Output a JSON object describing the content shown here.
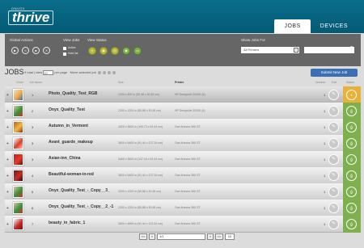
{
  "brand": {
    "subtitle": "ONVOX",
    "name": "thrive"
  },
  "tabs": [
    {
      "label": "JOBS",
      "active": true
    },
    {
      "label": "DEVICES",
      "active": false
    }
  ],
  "toolbar": {
    "global_actions_label": "Global Actions",
    "global_icons": [
      "play-icon",
      "pause-icon",
      "stop-icon",
      "cancel-icon"
    ],
    "view_jobs_label": "View Jobs",
    "view_jobs_options": [
      {
        "label": "Active",
        "checked": true
      },
      {
        "label": "Hold list",
        "checked": false
      }
    ],
    "view_status_label": "View Status",
    "status_icons": [
      "hold-status-icon",
      "rip-status-icon",
      "print-status-icon",
      "done-status-icon",
      "archive-status-icon"
    ],
    "show_jobs_for_label": "Show Jobs For",
    "printer_filter": "All Printers",
    "search_placeholder": ""
  },
  "jobs_bar": {
    "title": "JOBS",
    "count_text": "9 total | view",
    "per_page": "10",
    "per_page_label": "per page",
    "move_selected": "Move selected job",
    "submit_label": "Submit New Job"
  },
  "columns": {
    "order": "Order",
    "job_name": "Job Name",
    "size": "Size",
    "printer": "Printer",
    "copies": "Number",
    "edit": "Edit",
    "status": "Status"
  },
  "jobs": [
    {
      "order": "1",
      "name": "Photo_Quality_Test_RGB",
      "size": "1200 x 820 in (30.48 x 20.83 cm)",
      "printer": "HP DesignJet Z6100 (6)",
      "copies": "1",
      "status": "hold",
      "color": "#e8b23a",
      "thumb": [
        "#f2e2c0",
        "#f0a84b",
        "#3d6aa5"
      ]
    },
    {
      "order": "2",
      "name": "Onyx_Quality_Test",
      "size": "2200 x 1200 in (55.88 x 30.48 cm)",
      "printer": "HP DesignJet Z6100 (6)",
      "copies": "1",
      "status": "print",
      "color": "#7fb04e",
      "thumb": [
        "#d6c7a4",
        "#3b8e3b",
        "#d2312c"
      ]
    },
    {
      "order": "3",
      "name": "Autumn_in_Vermont",
      "size": "4320 x 3600 in (109.73 x 91.44 cm)",
      "printer": "Océ Arizona 350 GT",
      "copies": "1",
      "status": "print",
      "color": "#7fb04e",
      "thumb": [
        "#c75a1a",
        "#f0b94a",
        "#8c3012"
      ]
    },
    {
      "order": "3",
      "name": "Avant_guarde_makeup",
      "size": "3600 x 5400 in (91.44 x 137.16 cm)",
      "printer": "Océ Arizona 350 GT",
      "copies": "1",
      "status": "print",
      "color": "#7fb04e",
      "thumb": [
        "#fff",
        "#d73c2c",
        "#f4c8b0"
      ]
    },
    {
      "order": "3",
      "name": "Asian-inn_China",
      "size": "5400 x 3600 in (137.16 x 91.44 cm)",
      "printer": "Océ Arizona 350 GT",
      "copies": "1",
      "status": "print",
      "color": "#7fb04e",
      "thumb": [
        "#b81f1f",
        "#e53a2a",
        "#5a0f0f"
      ]
    },
    {
      "order": "4",
      "name": "Beautiful-woman-in-red",
      "size": "3600 x 5400 in (91.44 x 137.16 cm)",
      "printer": "Océ Arizona 350 GT",
      "copies": "1",
      "status": "print",
      "color": "#7fb04e",
      "thumb": [
        "#7a1418",
        "#c43028",
        "#2b0a0a"
      ]
    },
    {
      "order": "5",
      "name": "Onyx_Quality_Test_-_Copy__3_",
      "size": "2200 x 1200 in (55.88 x 30.48 cm)",
      "printer": "Océ Arizona 350 GT",
      "copies": "1",
      "status": "print",
      "color": "#7fb04e",
      "thumb": [
        "#d6c7a4",
        "#3b8e3b",
        "#d2312c"
      ]
    },
    {
      "order": "6",
      "name": "Onyx_Quality_Test_-_Copy__2_-1",
      "size": "2200 x 1200 in (55.88 x 30.48 cm)",
      "printer": "Océ Arizona 350 GT",
      "copies": "1",
      "status": "print",
      "color": "#7fb04e",
      "thumb": [
        "#d6c7a4",
        "#3b8e3b",
        "#d2312c"
      ]
    },
    {
      "order": "7",
      "name": "beauty_in_fabric_1",
      "size": "3600 x 4800 in (91.44 x 121.92 cm)",
      "printer": "Océ Arizona 350 GT",
      "copies": "1",
      "status": "print",
      "color": "#7fb04e",
      "thumb": [
        "#fff",
        "#c62b2b",
        "#7a1212"
      ]
    }
  ],
  "pager": {
    "first": "<<",
    "prev": "<",
    "page": "1/1",
    "next": ">",
    "last": ">>",
    "per_page": "10"
  }
}
